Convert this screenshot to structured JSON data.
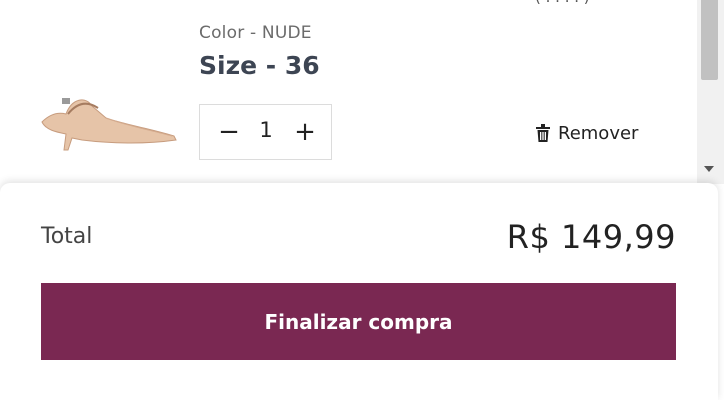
{
  "cart_item": {
    "color_text": "Color - NUDE",
    "size_text": "Size - 36",
    "quantity": "1",
    "decrement_symbol": "−",
    "increment_symbol": "+",
    "remove_label": "Remover",
    "cut_off_text": "( . . . . )",
    "image_icon": "nude-slingback-shoe"
  },
  "summary": {
    "total_label": "Total",
    "total_value": "R$ 149,99",
    "checkout_label": "Finalizar compra"
  },
  "colors": {
    "checkout_bg": "#7a2852",
    "size_text": "#3d4553",
    "shoe": "#e6c4a8"
  }
}
